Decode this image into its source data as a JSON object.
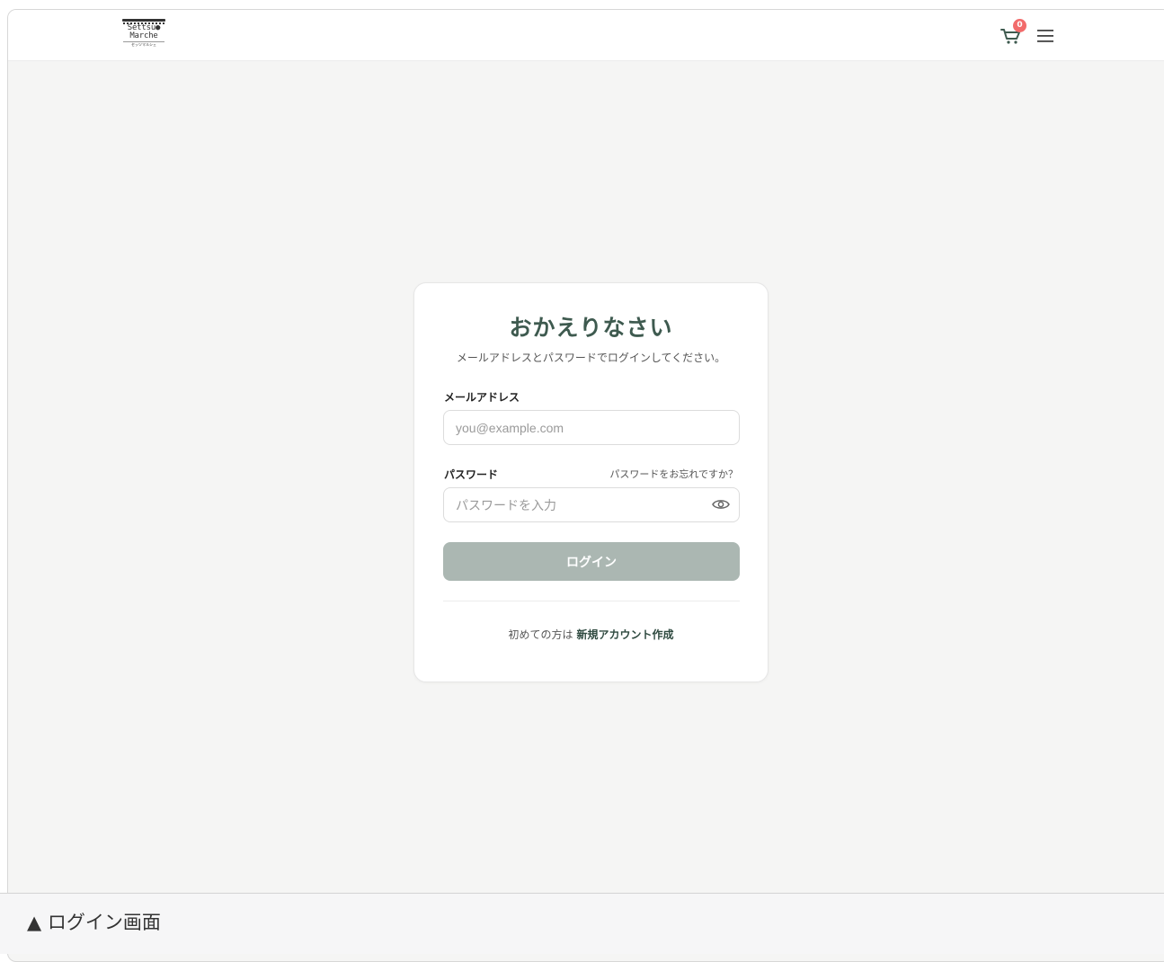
{
  "header": {
    "logo_line1": "Settsu●",
    "logo_line2": "Marche",
    "logo_line3": "セッツマルシェ",
    "cart_count": "0"
  },
  "login": {
    "title": "おかえりなさい",
    "subtitle": "メールアドレスとパスワードでログインしてください。",
    "email_label": "メールアドレス",
    "email_placeholder": "you@example.com",
    "password_label": "パスワード",
    "forgot_link": "パスワードをお忘れですか？",
    "password_placeholder": "パスワードを入力",
    "login_button": "ログイン",
    "signup_prefix": "初めての方は",
    "signup_link": "新規アカウント作成"
  },
  "caption": "▲ ログイン画面",
  "colors": {
    "accent": "#3e5a4f",
    "button": "#abb7b2",
    "badge": "#f26b6b",
    "background": "#f5f5f4"
  },
  "icons": [
    "cart-icon",
    "hamburger-menu-icon",
    "eye-icon"
  ]
}
